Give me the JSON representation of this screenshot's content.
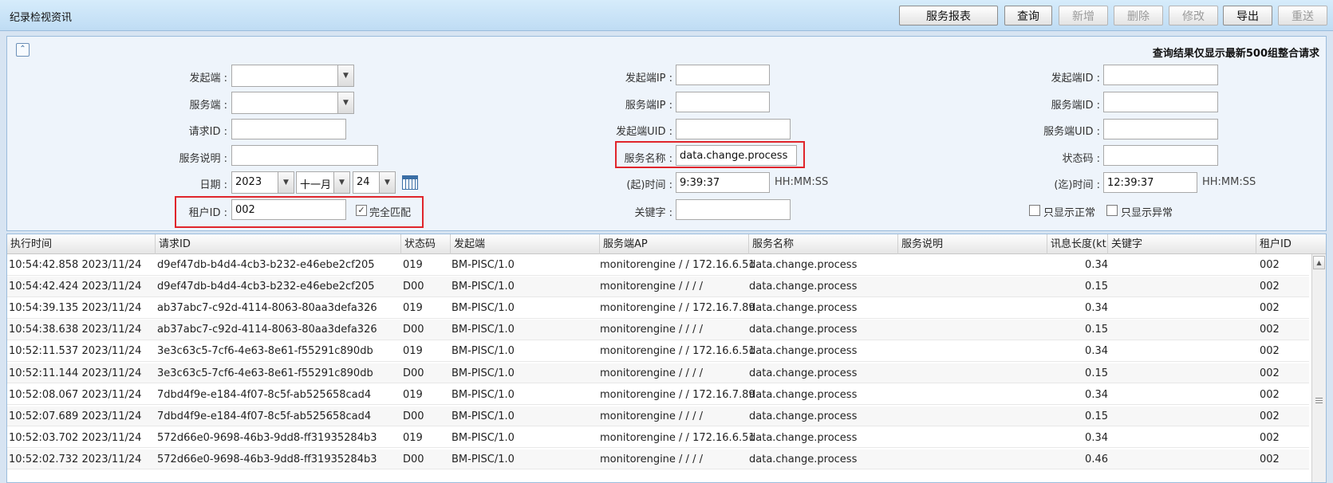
{
  "window": {
    "title": "纪录检视资讯"
  },
  "toolbar": {
    "report": "服务报表",
    "query": "查询",
    "add": "新增",
    "delete": "删除",
    "edit": "修改",
    "export": "导出",
    "resend": "重送"
  },
  "query": {
    "collapse_glyph": "⌃",
    "notice": "查询结果仅显示最新500组整合请求",
    "col1": {
      "initiator_label": "发起端 :",
      "initiator_value": "",
      "server_label": "服务端 :",
      "server_value": "",
      "request_id_label": "请求ID :",
      "request_id_value": "",
      "service_desc_label": "服务说明 :",
      "service_desc_value": "",
      "date_label": "日期 :",
      "year": "2023",
      "month": "十一月",
      "day": "24",
      "tenant_label": "租户ID :",
      "tenant_value": "002",
      "exact_match_label": "完全匹配",
      "exact_match_checked": true
    },
    "col2": {
      "initiator_ip_label": "发起端IP :",
      "initiator_ip_value": "",
      "server_ip_label": "服务端IP :",
      "server_ip_value": "",
      "initiator_uid_label": "发起端UID :",
      "initiator_uid_value": "",
      "service_name_label": "服务名称 :",
      "service_name_value": "data.change.process",
      "start_time_label": "(起)时间 :",
      "start_time_value": "9:39:37",
      "start_time_hint": "HH:MM:SS",
      "keyword_label": "关键字 :",
      "keyword_value": ""
    },
    "col3": {
      "initiator_id_label": "发起端ID :",
      "initiator_id_value": "",
      "server_id_label": "服务端ID :",
      "server_id_value": "",
      "server_uid_label": "服务端UID :",
      "server_uid_value": "",
      "status_code_label": "状态码 :",
      "status_code_value": "",
      "end_time_label": "(迄)时间 :",
      "end_time_value": "12:39:37",
      "end_time_hint": "HH:MM:SS",
      "only_normal_label": "只显示正常",
      "only_abnormal_label": "只显示异常"
    }
  },
  "grid": {
    "columns": [
      "执行时间",
      "请求ID",
      "状态码",
      "发起端",
      "服务端AP",
      "服务名称",
      "服务说明",
      "讯息长度(kt",
      "关键字",
      "租户ID"
    ],
    "rows": [
      [
        "10:54:42.858 2023/11/24",
        "d9ef47db-b4d4-4cb3-b232-e46ebe2cf205",
        "019",
        "BM-PISC/1.0",
        "monitorengine / / 172.16.6.51",
        "data.change.process",
        "",
        "0.34",
        "",
        "002"
      ],
      [
        "10:54:42.424 2023/11/24",
        "d9ef47db-b4d4-4cb3-b232-e46ebe2cf205",
        "D00",
        "BM-PISC/1.0",
        "monitorengine / / / /",
        "data.change.process",
        "",
        "0.15",
        "",
        "002"
      ],
      [
        "10:54:39.135 2023/11/24",
        "ab37abc7-c92d-4114-8063-80aa3defa326",
        "019",
        "BM-PISC/1.0",
        "monitorengine / / 172.16.7.89",
        "data.change.process",
        "",
        "0.34",
        "",
        "002"
      ],
      [
        "10:54:38.638 2023/11/24",
        "ab37abc7-c92d-4114-8063-80aa3defa326",
        "D00",
        "BM-PISC/1.0",
        "monitorengine / / / /",
        "data.change.process",
        "",
        "0.15",
        "",
        "002"
      ],
      [
        "10:52:11.537 2023/11/24",
        "3e3c63c5-7cf6-4e63-8e61-f55291c890db",
        "019",
        "BM-PISC/1.0",
        "monitorengine / / 172.16.6.51",
        "data.change.process",
        "",
        "0.34",
        "",
        "002"
      ],
      [
        "10:52:11.144 2023/11/24",
        "3e3c63c5-7cf6-4e63-8e61-f55291c890db",
        "D00",
        "BM-PISC/1.0",
        "monitorengine / / / /",
        "data.change.process",
        "",
        "0.15",
        "",
        "002"
      ],
      [
        "10:52:08.067 2023/11/24",
        "7dbd4f9e-e184-4f07-8c5f-ab525658cad4",
        "019",
        "BM-PISC/1.0",
        "monitorengine / / 172.16.7.89",
        "data.change.process",
        "",
        "0.34",
        "",
        "002"
      ],
      [
        "10:52:07.689 2023/11/24",
        "7dbd4f9e-e184-4f07-8c5f-ab525658cad4",
        "D00",
        "BM-PISC/1.0",
        "monitorengine / / / /",
        "data.change.process",
        "",
        "0.15",
        "",
        "002"
      ],
      [
        "10:52:03.702 2023/11/24",
        "572d66e0-9698-46b3-9dd8-ff31935284b3",
        "019",
        "BM-PISC/1.0",
        "monitorengine / / 172.16.6.51",
        "data.change.process",
        "",
        "0.34",
        "",
        "002"
      ],
      [
        "10:52:02.732 2023/11/24",
        "572d66e0-9698-46b3-9dd8-ff31935284b3",
        "D00",
        "BM-PISC/1.0",
        "monitorengine / / / /",
        "data.change.process",
        "",
        "0.46",
        "",
        "002"
      ]
    ]
  }
}
